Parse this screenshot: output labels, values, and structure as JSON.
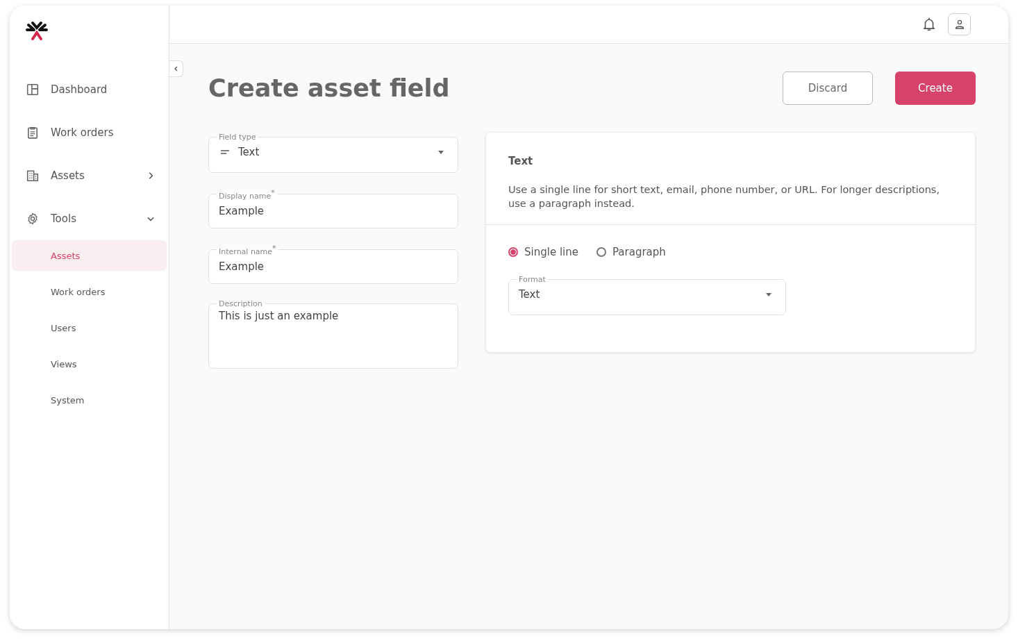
{
  "sidebar": {
    "items": [
      {
        "label": "Dashboard",
        "selected": false
      },
      {
        "label": "Work orders",
        "selected": false
      },
      {
        "label": "Assets",
        "selected": false,
        "expanded": false
      },
      {
        "label": "Tools",
        "selected": false,
        "expanded": true,
        "children": [
          {
            "label": "Assets",
            "selected": true
          },
          {
            "label": "Work orders",
            "selected": false
          },
          {
            "label": "Users",
            "selected": false
          },
          {
            "label": "Views",
            "selected": false
          },
          {
            "label": "System",
            "selected": false
          }
        ]
      }
    ]
  },
  "page": {
    "title": "Create asset field",
    "buttons": [
      {
        "label": "Discard",
        "kind": "secondary"
      },
      {
        "label": "Create",
        "kind": "primary"
      }
    ]
  },
  "form": {
    "fields": [
      {
        "kind": "select",
        "label": "Field type",
        "value": "Text"
      },
      {
        "kind": "input",
        "label": "Display name",
        "value": "Example",
        "required_mark": "*"
      },
      {
        "kind": "input",
        "label": "Internal name",
        "value": "Example",
        "required_mark": "*"
      },
      {
        "kind": "textarea",
        "label": "Description",
        "value": "This is just an example"
      }
    ]
  },
  "info_card": {
    "title": "Text",
    "description": "Use a single line for short text, email, phone number, or URL. For longer descriptions, use a paragraph instead.",
    "options": [
      {
        "label": "Single line",
        "selected": true
      },
      {
        "label": "Paragraph",
        "selected": false
      }
    ],
    "format": {
      "label": "Format",
      "value": "Text"
    }
  }
}
